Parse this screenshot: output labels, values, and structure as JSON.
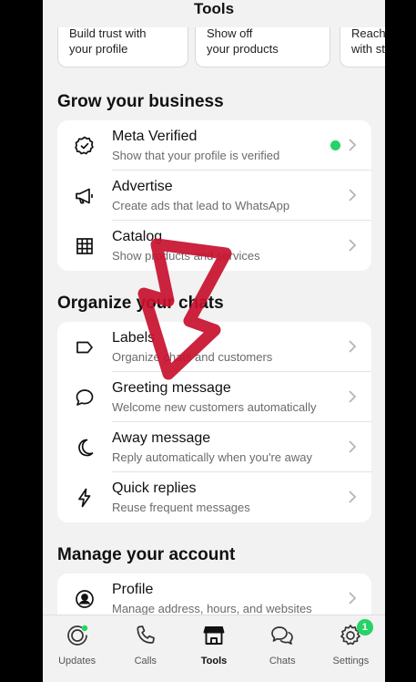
{
  "header": {
    "title": "Tools"
  },
  "top_cards": [
    {
      "line1": "Build trust with",
      "line2": "your profile"
    },
    {
      "line1": "Show off",
      "line2": "your products"
    },
    {
      "line1": "Reach",
      "line2": "with st"
    }
  ],
  "sections": {
    "grow": {
      "title": "Grow your business",
      "items": [
        {
          "title": "Meta Verified",
          "subtitle": "Show that your profile is verified",
          "icon": "verified-badge-icon",
          "status_dot_color": "#25d366"
        },
        {
          "title": "Advertise",
          "subtitle": "Create ads that lead to WhatsApp",
          "icon": "megaphone-icon"
        },
        {
          "title": "Catalog",
          "subtitle": "Show products and services",
          "icon": "grid-icon"
        }
      ]
    },
    "organize": {
      "title": "Organize your chats",
      "items": [
        {
          "title": "Labels",
          "subtitle": "Organize chats and customers",
          "icon": "label-icon"
        },
        {
          "title": "Greeting message",
          "subtitle": "Welcome new customers automatically",
          "icon": "chat-bubble-icon"
        },
        {
          "title": "Away message",
          "subtitle": "Reply automatically when you're away",
          "icon": "moon-icon"
        },
        {
          "title": "Quick replies",
          "subtitle": "Reuse frequent messages",
          "icon": "lightning-icon"
        }
      ]
    },
    "manage": {
      "title": "Manage your account",
      "items": [
        {
          "title": "Profile",
          "subtitle": "Manage address, hours, and websites",
          "icon": "profile-icon"
        }
      ]
    }
  },
  "tabbar": {
    "tabs": [
      {
        "label": "Updates",
        "icon": "updates-icon"
      },
      {
        "label": "Calls",
        "icon": "phone-icon"
      },
      {
        "label": "Tools",
        "icon": "store-icon",
        "active": true
      },
      {
        "label": "Chats",
        "icon": "chats-icon"
      },
      {
        "label": "Settings",
        "icon": "gear-icon",
        "badge": "1"
      }
    ]
  },
  "colors": {
    "accent": "#25d366",
    "annotation_arrow": "#c8102e",
    "background": "#f2f2f2"
  }
}
